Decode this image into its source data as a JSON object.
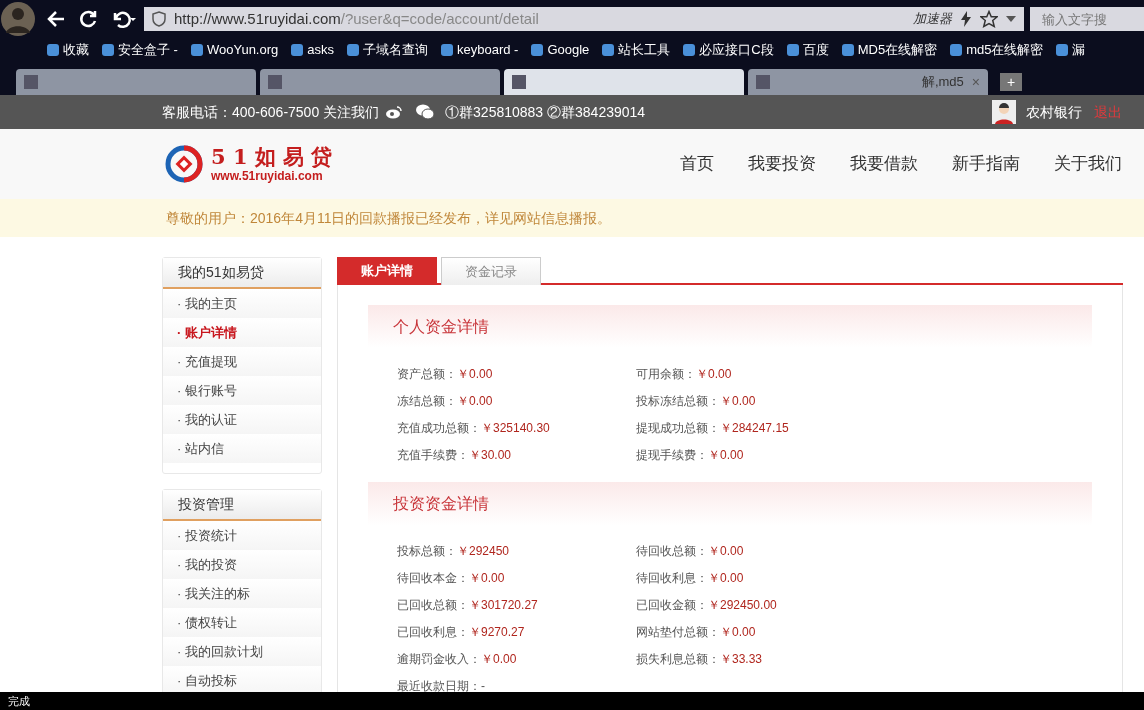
{
  "browser": {
    "address_host": "http://www.51ruyidai.com",
    "address_path": "/?user&q=code/account/detail",
    "accelerator": "加速器",
    "search_placeholder": "输入文字搜",
    "bookmarks": [
      {
        "label": "收藏"
      },
      {
        "label": "安全盒子 -"
      },
      {
        "label": "WooYun.org"
      },
      {
        "label": "asks"
      },
      {
        "label": "子域名查询"
      },
      {
        "label": "keyboard -"
      },
      {
        "label": "Google"
      },
      {
        "label": "站长工具"
      },
      {
        "label": "必应接口C段"
      },
      {
        "label": "百度"
      },
      {
        "label": "MD5在线解密"
      },
      {
        "label": "md5在线解密"
      },
      {
        "label": "漏"
      }
    ],
    "tabs": [
      {
        "selected": false
      },
      {
        "selected": false
      },
      {
        "selected": true
      },
      {
        "label": "解,md5",
        "selected": false
      }
    ],
    "close_tab": "×",
    "new_tab": "+",
    "status": "完成"
  },
  "topbar": {
    "contact": "客服电话：400-606-7500 关注我们",
    "groups": "①群325810883 ②群384239014",
    "user": "农村银行",
    "logout": "退出"
  },
  "logo": {
    "name": "5 1 如 易 贷",
    "url": "www.51ruyidai.com"
  },
  "nav": [
    "首页",
    "我要投资",
    "我要借款",
    "新手指南",
    "关于我们"
  ],
  "notice": "尊敬的用户：2016年4月11日的回款播报已经发布，详见网站信息播报。",
  "sidebar": [
    {
      "title": "我的51如易贷",
      "items": [
        {
          "label": "· 我的主页",
          "selected": false
        },
        {
          "label": "· 账户详情",
          "selected": true
        },
        {
          "label": "· 充值提现",
          "selected": false
        },
        {
          "label": "· 银行账号",
          "selected": false
        },
        {
          "label": "· 我的认证",
          "selected": false
        },
        {
          "label": "· 站内信",
          "selected": false
        }
      ]
    },
    {
      "title": "投资管理",
      "items": [
        {
          "label": "· 投资统计",
          "selected": false
        },
        {
          "label": "· 我的投资",
          "selected": false
        },
        {
          "label": "· 我关注的标",
          "selected": false
        },
        {
          "label": "· 债权转让",
          "selected": false
        },
        {
          "label": "· 我的回款计划",
          "selected": false
        },
        {
          "label": "· 自动投标",
          "selected": false
        }
      ]
    }
  ],
  "tabs": [
    {
      "label": "账户详情",
      "selected": true
    },
    {
      "label": "资金记录",
      "selected": false
    }
  ],
  "sections": [
    {
      "title": "个人资金详情",
      "fields": [
        {
          "label": "资产总额：",
          "value": "￥0.00"
        },
        {
          "label": "可用余额：",
          "value": "￥0.00"
        },
        {
          "label": "冻结总额：",
          "value": "￥0.00"
        },
        {
          "label": "投标冻结总额：",
          "value": "￥0.00"
        },
        {
          "label": "充值成功总额：",
          "value": "￥325140.30"
        },
        {
          "label": "提现成功总额：",
          "value": "￥284247.15"
        },
        {
          "label": "充值手续费：",
          "value": "￥30.00"
        },
        {
          "label": "提现手续费：",
          "value": "￥0.00"
        }
      ]
    },
    {
      "title": "投资资金详情",
      "fields": [
        {
          "label": "投标总额：",
          "value": "￥292450"
        },
        {
          "label": "待回收总额：",
          "value": "￥0.00"
        },
        {
          "label": "待回收本金：",
          "value": "￥0.00"
        },
        {
          "label": "待回收利息：",
          "value": "￥0.00"
        },
        {
          "label": "已回收总额：",
          "value": "￥301720.27"
        },
        {
          "label": "已回收金额：",
          "value": "￥292450.00"
        },
        {
          "label": "已回收利息：",
          "value": "￥9270.27"
        },
        {
          "label": "网站垫付总额：",
          "value": "￥0.00"
        },
        {
          "label": "逾期罚金收入：",
          "value": "￥0.00"
        },
        {
          "label": "损失利息总额：",
          "value": "￥33.33"
        },
        {
          "label": "最近收款日期：-"
        }
      ]
    }
  ]
}
